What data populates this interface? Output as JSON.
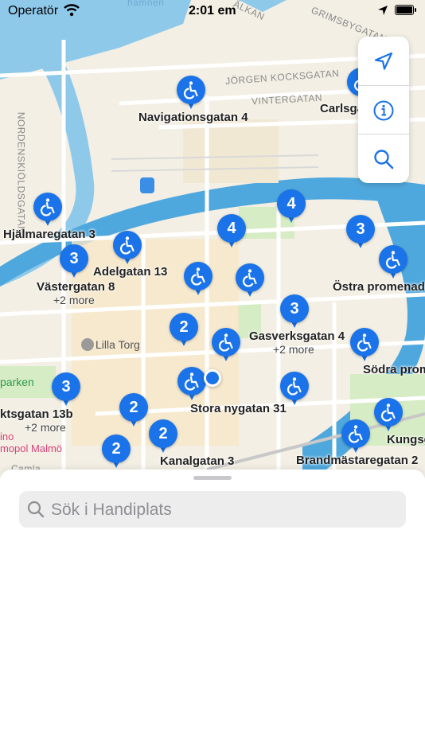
{
  "status_bar": {
    "carrier": "Operatör",
    "time": "2:01 em"
  },
  "map": {
    "street_labels": [
      "JÖRGEN KOCKSGATAN",
      "VINTERGATAN",
      "GRIMSBYGATAN",
      "NORDENSKIÖLDSGATAN",
      "ÄLKAN",
      "hamnen",
      "Camla"
    ],
    "poi_labels": [
      "Lilla Torg",
      "parken",
      "ino",
      "mopol Malmö"
    ],
    "places": [
      {
        "name": "Navigationsgatan 4"
      },
      {
        "name": "Carlsga"
      },
      {
        "name": "Hjälmaregatan 3"
      },
      {
        "name": "Adelgatan 13"
      },
      {
        "name": "Västergatan 8",
        "more": "+2 more"
      },
      {
        "name": "Östra promenade"
      },
      {
        "name": "Gasverksgatan 4",
        "more": "+2 more"
      },
      {
        "name": "Södra prom"
      },
      {
        "name": "ktsgatan 13b",
        "more": "+2 more"
      },
      {
        "name": "Stora nygatan 31"
      },
      {
        "name": "Kungsg"
      },
      {
        "name": "Kanalgatan 3"
      },
      {
        "name": "Brandmästaregatan 2"
      }
    ],
    "cluster_counts": [
      "4",
      "4",
      "3",
      "3",
      "3",
      "2",
      "3",
      "2",
      "2",
      "2"
    ],
    "pin_icon": "wheelchair-icon",
    "accent_color": "#1a73e8"
  },
  "controls": [
    {
      "icon": "location-arrow-icon"
    },
    {
      "icon": "info-icon"
    },
    {
      "icon": "search-icon"
    }
  ],
  "sheet": {
    "search_placeholder": "Sök i Handiplats"
  }
}
